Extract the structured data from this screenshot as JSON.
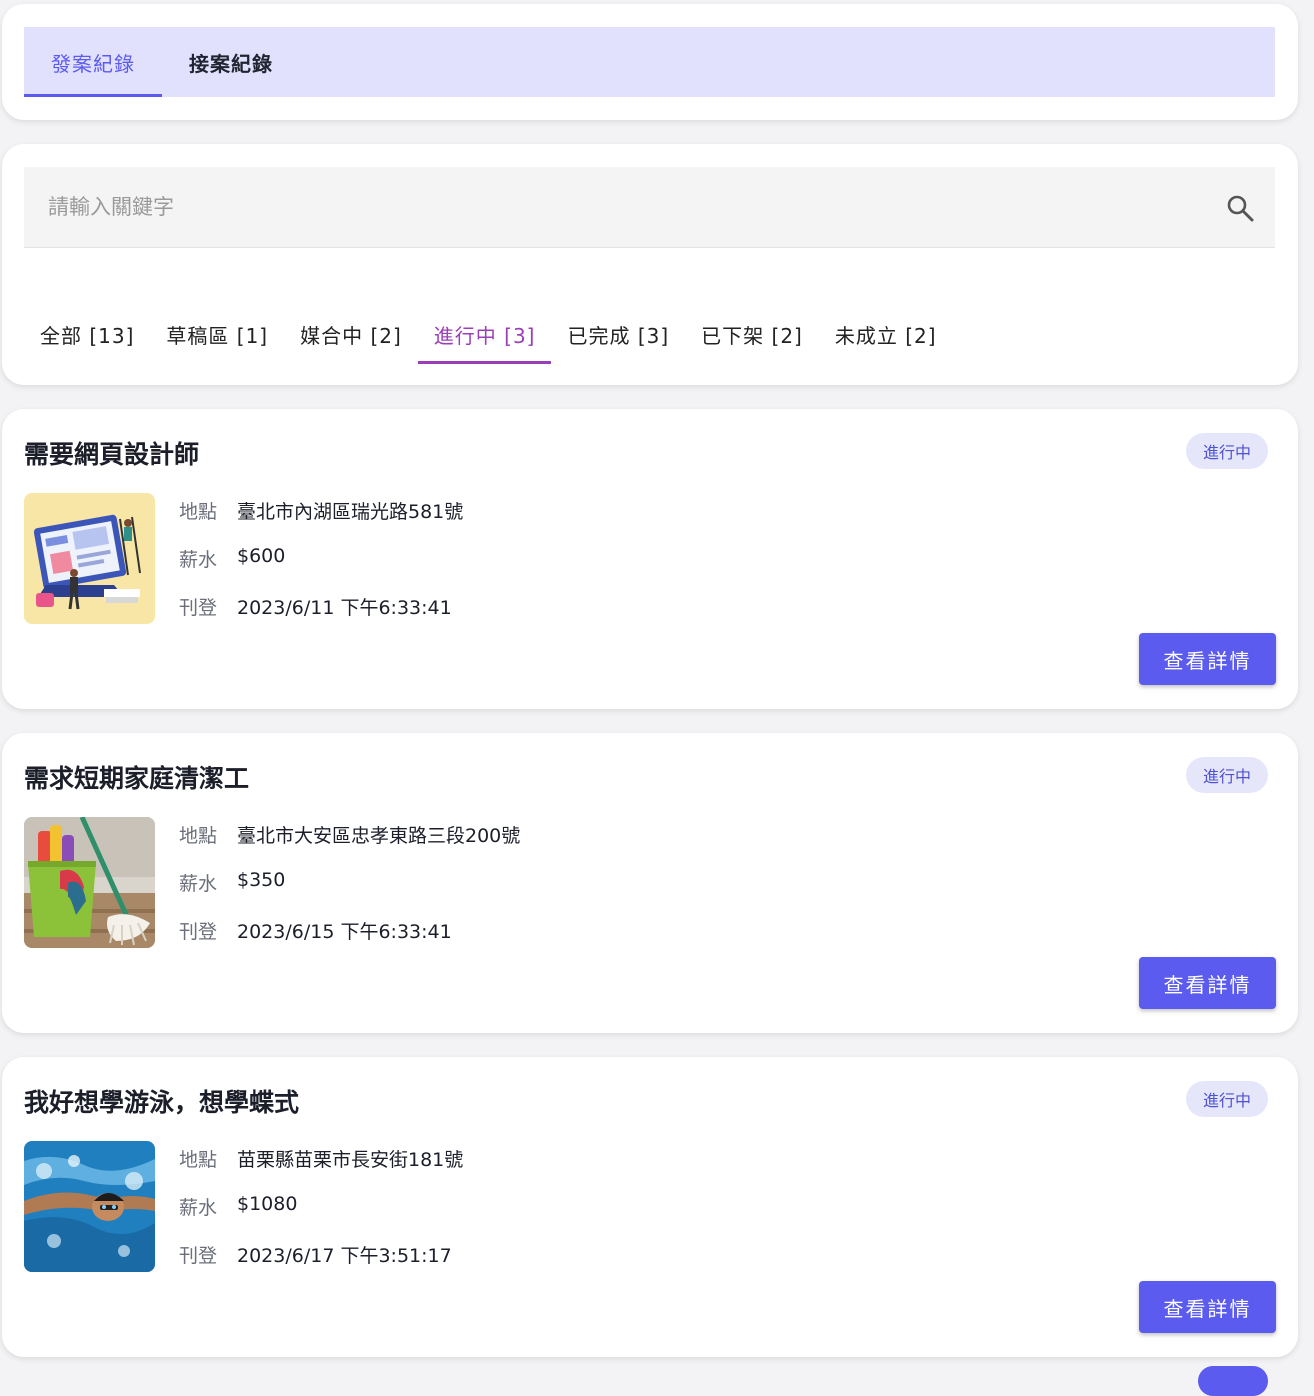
{
  "tabs": [
    {
      "label": "發案紀錄",
      "active": true
    },
    {
      "label": "接案紀錄",
      "active": false
    }
  ],
  "search": {
    "placeholder": "請輸入關鍵字"
  },
  "filters": [
    {
      "label": "全部 [13]"
    },
    {
      "label": "草稿區 [1]"
    },
    {
      "label": "媒合中 [2]"
    },
    {
      "label": "進行中 [3]"
    },
    {
      "label": "已完成 [3]"
    },
    {
      "label": "已下架 [2]"
    },
    {
      "label": "未成立 [2]"
    }
  ],
  "active_filter_index": 3,
  "labels": {
    "location": "地點",
    "salary": "薪水",
    "posted": "刊登"
  },
  "jobs": [
    {
      "title": "需要網頁設計師",
      "status": "進行中",
      "location": "臺北市內湖區瑞光路581號",
      "salary": "$600",
      "posted": "2023/6/11 下午6:33:41",
      "button": "查看詳情",
      "image": "web-design-illustration"
    },
    {
      "title": "需求短期家庭清潔工",
      "status": "進行中",
      "location": "臺北市大安區忠孝東路三段200號",
      "salary": "$350",
      "posted": "2023/6/15 下午6:33:41",
      "button": "查看詳情",
      "image": "cleaning-supplies-photo"
    },
    {
      "title": "我好想學游泳，想學蝶式",
      "status": "進行中",
      "location": "苗栗縣苗栗市長安街181號",
      "salary": "$1080",
      "posted": "2023/6/17 下午3:51:17",
      "button": "查看詳情",
      "image": "butterfly-swimmer-photo"
    }
  ],
  "colors": {
    "accent": "#5b5bef",
    "tab_bar_bg": "#e2e1fd",
    "active_filter": "#9b3fb8",
    "badge_bg": "#e6e6fb"
  }
}
